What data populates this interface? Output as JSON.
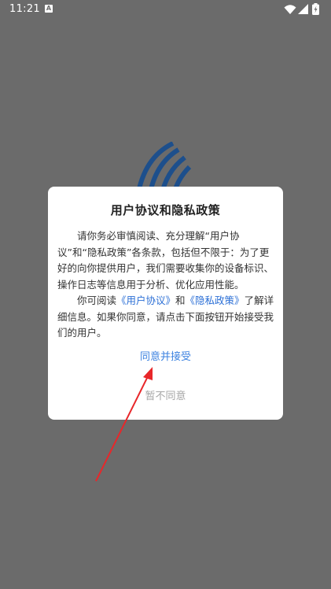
{
  "status_bar": {
    "time": "11:21",
    "notification_letter": "A"
  },
  "dialog": {
    "title": "用户协议和隐私政策",
    "paragraph1": "请你务必审慎阅读、充分理解“用户协议”和“隐私政策”各条款，包括但不限于：为了更好的向你提供用户，我们需要收集你的设备标识、操作日志等信息用于分析、优化应用性能。",
    "paragraph2_prefix": "你可阅读",
    "user_agreement_link": "《用户协议》",
    "paragraph2_and": "和",
    "privacy_policy_link": "《隐私政策》",
    "paragraph2_suffix": "了解详细信息。如果你同意，请点击下面按钮开始接受我们的用户。",
    "accept_label": "同意并接受",
    "decline_label": "暂不同意"
  },
  "colors": {
    "overlay_background": "#6b6b6b",
    "link": "#2b6fd6",
    "accept": "#3c82e0",
    "decline": "#a6a6a6",
    "arrow": "#e8272a",
    "logo": "#1d4f8c"
  }
}
